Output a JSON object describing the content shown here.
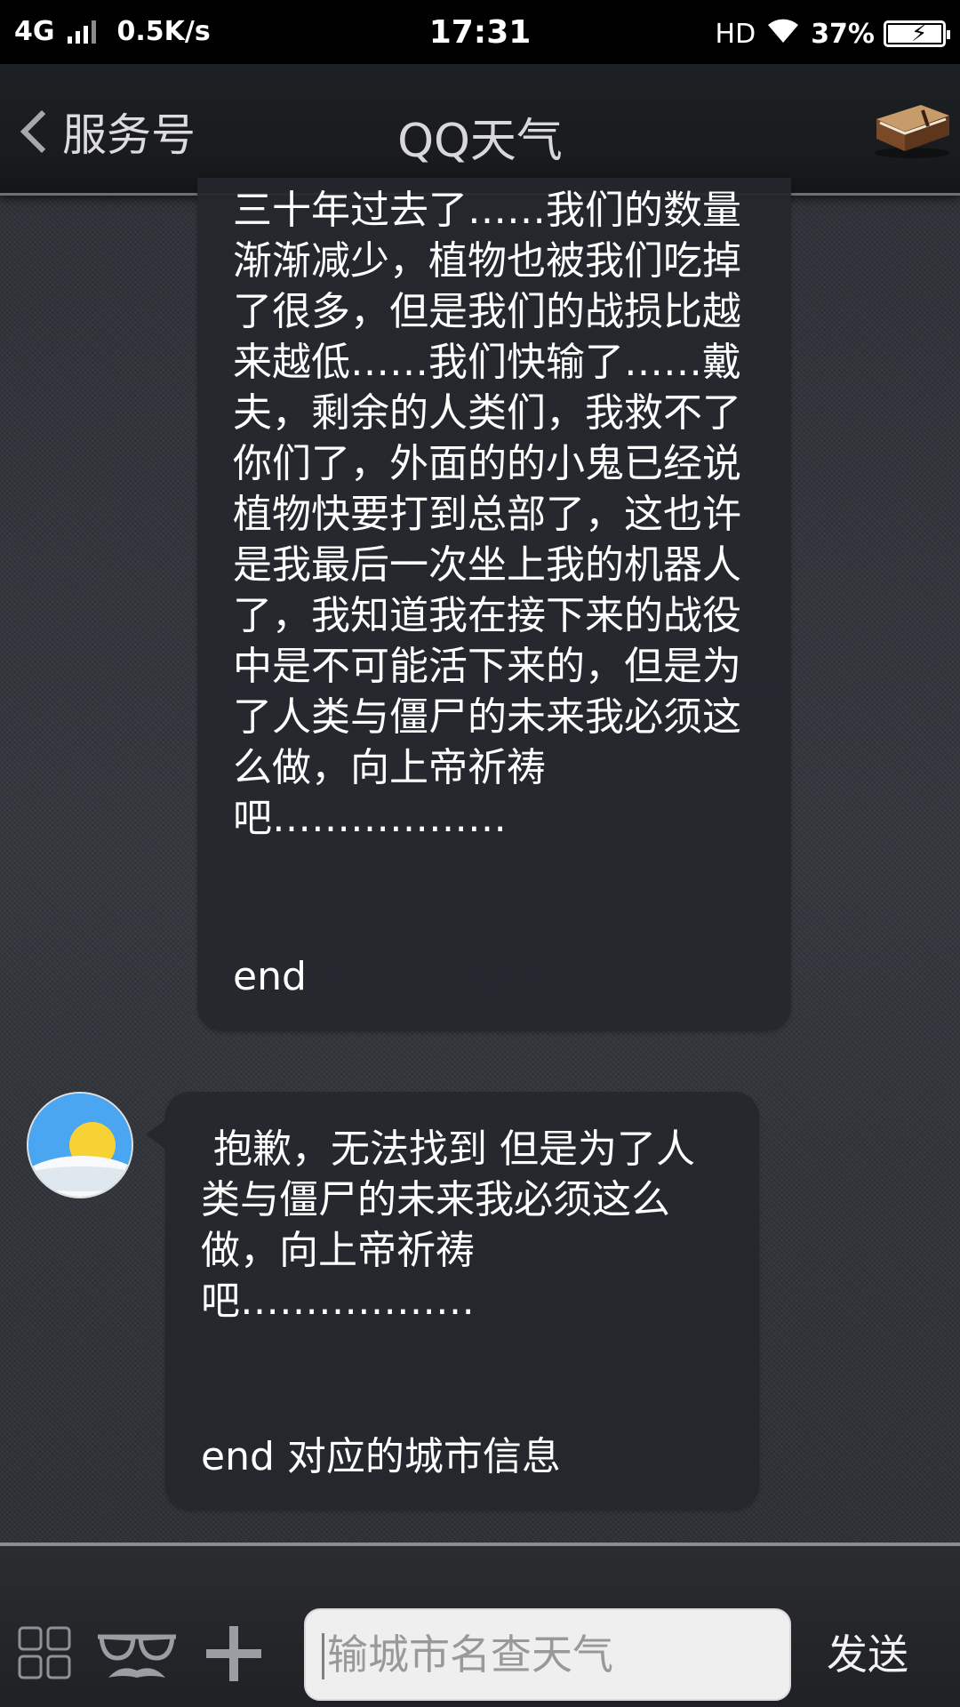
{
  "status_bar": {
    "network": "4G",
    "speed": "0.5K/s",
    "time": "17:31",
    "hd": "HD",
    "battery": "37%",
    "battery_level": 0.37
  },
  "header": {
    "back_label": "服务号",
    "title": "QQ天气",
    "menu_icon": "book-icon"
  },
  "messages": [
    {
      "sender": "user",
      "text": "三十年过去了……我们的数量渐渐减少，植物也被我们吃掉了很多，但是我们的战损比越来越低……我们快输了……戴夫，剩余的人类们，我救不了你们了，外面的的小鬼已经说植物快要打到总部了，这也许是我最后一次坐上我的机器人了，我知道我在接下来的战役中是不可能活下来的，但是为了人类与僵尸的未来我必须这么做，向上帝祈祷吧………………",
      "tail": "end"
    },
    {
      "sender": "bot",
      "avatar_icon": "sun-avatar-icon",
      "text": " 抱歉，无法找到 但是为了人类与僵尸的未来我必须这么做，向上帝祈祷吧………………",
      "tail": "end 对应的城市信息"
    }
  ],
  "composer": {
    "placeholder": "输城市名查天气",
    "send_label": "发送",
    "icons": [
      "grid-icon",
      "glasses-mustache-icon",
      "plus-icon"
    ]
  },
  "colors": {
    "bubble": "#24272c",
    "background": "#2e3237",
    "text": "#ffffff",
    "header": "#191b1e"
  }
}
